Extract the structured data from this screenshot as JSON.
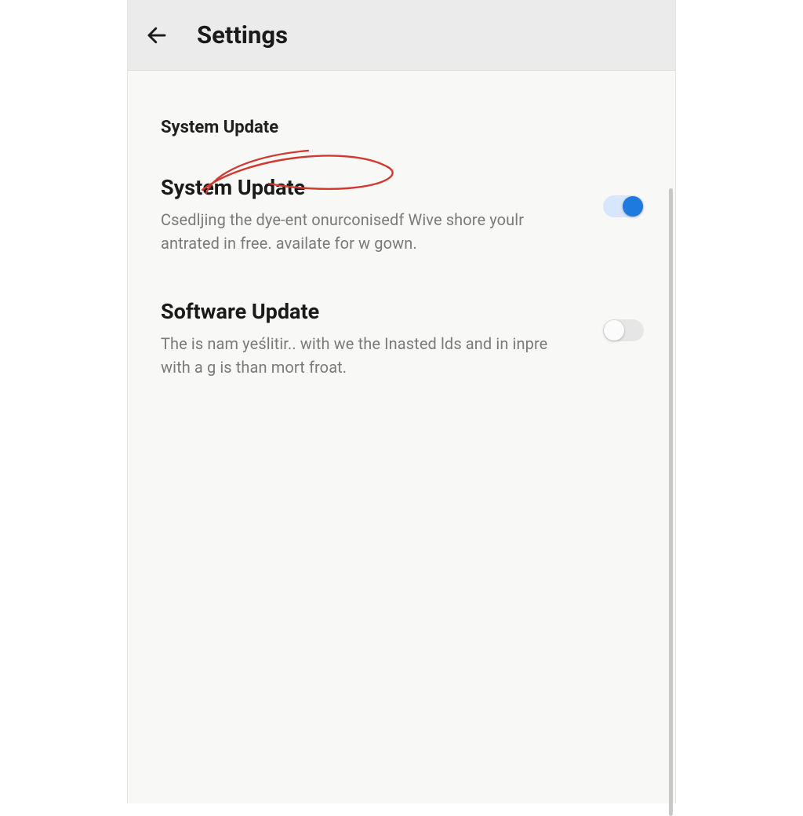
{
  "header": {
    "title": "Settings"
  },
  "section": {
    "header": "System Update",
    "items": [
      {
        "title": "System Update",
        "description": "Csedljing the dye-ent onurconisedf Wive shore youlr antrated in free. availate for w gown.",
        "enabled": true
      },
      {
        "title": "Software Update",
        "description": "The is nam yeślitir.. with we the Inasted lds and in inpre with a g is than mort froat.",
        "enabled": false
      }
    ]
  }
}
